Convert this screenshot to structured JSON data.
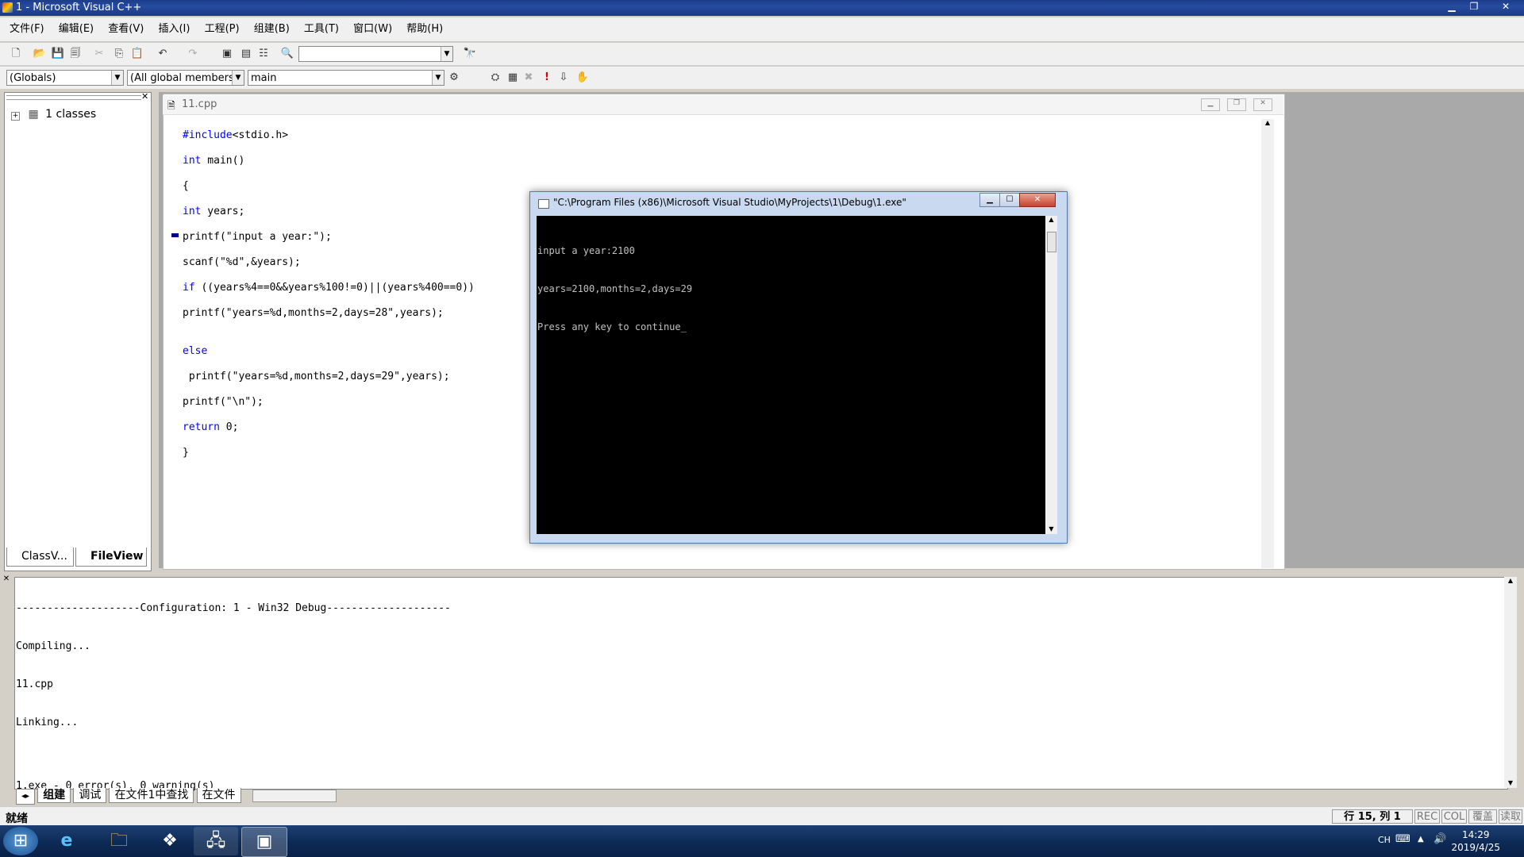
{
  "window": {
    "title": "1 - Microsoft Visual C++"
  },
  "menu": [
    "文件(F)",
    "编辑(E)",
    "查看(V)",
    "插入(I)",
    "工程(P)",
    "组建(B)",
    "工具(T)",
    "窗口(W)",
    "帮助(H)"
  ],
  "wizardbar": {
    "scope": "(Globals)",
    "filter": "(All global members",
    "member": "main"
  },
  "workspace": {
    "tree_root": "1 classes",
    "tabs": [
      "ClassV...",
      "FileView"
    ]
  },
  "editor": {
    "file_title": "11.cpp",
    "code_lines": [
      "#include<stdio.h>",
      "int main()",
      "{",
      "int years;",
      "printf(\"input a year:\");",
      "scanf(\"%d\",&years);",
      "if ((years%4==0&&years%100!=0)||(years%400==0))",
      "printf(\"years=%d,months=2,days=28\",years);",
      "",
      "else",
      " printf(\"years=%d,months=2,days=29\",years);",
      "printf(\"\\n\");",
      "return 0;",
      "}"
    ]
  },
  "console": {
    "title": "\"C:\\Program Files (x86)\\Microsoft Visual Studio\\MyProjects\\1\\Debug\\1.exe\"",
    "lines": [
      "input a year:2100",
      "years=2100,months=2,days=29",
      "Press any key to continue_"
    ]
  },
  "output": {
    "lines": [
      "--------------------Configuration: 1 - Win32 Debug--------------------",
      "Compiling...",
      "11.cpp",
      "Linking...",
      "",
      "1.exe - 0 error(s), 0 warning(s)"
    ],
    "tabs": [
      "组建",
      "调试",
      "在文件1中查找",
      "在文件"
    ]
  },
  "status": {
    "left": "就绪",
    "position": "行 15, 列 1",
    "indicators": [
      "REC",
      "COL",
      "覆盖",
      "读取"
    ]
  },
  "taskbar": {
    "time": "14:29",
    "date": "2019/4/25",
    "lang": "CH"
  }
}
